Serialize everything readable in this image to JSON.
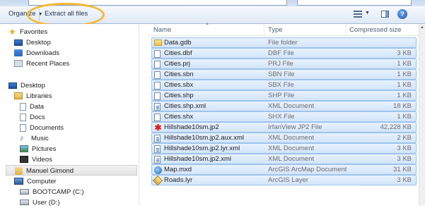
{
  "toolbar": {
    "organize_label": "Organize",
    "extract_label": "Extract all files"
  },
  "nav": {
    "favorites": "Favorites",
    "fav_items": [
      "Desktop",
      "Downloads",
      "Recent Places"
    ],
    "desktop": "Desktop",
    "libraries": "Libraries",
    "library_items": [
      "Data",
      "Docs",
      "Documents",
      "Music",
      "Pictures",
      "Videos"
    ],
    "user": "Manuel Gimond",
    "computer": "Computer",
    "drives": [
      "BOOTCAMP (C:)",
      "User (D:)"
    ]
  },
  "columns": {
    "name": "Name",
    "type": "Type",
    "size": "Compressed size"
  },
  "files": [
    {
      "name": "Data.gdb",
      "type": "File folder",
      "size": "",
      "icon": "folder-icon"
    },
    {
      "name": "Cities.dbf",
      "type": "DBF File",
      "size": "3 KB",
      "icon": "file-icon"
    },
    {
      "name": "Cities.prj",
      "type": "PRJ File",
      "size": "1 KB",
      "icon": "file-icon"
    },
    {
      "name": "Cities.sbn",
      "type": "SBN File",
      "size": "1 KB",
      "icon": "file-icon"
    },
    {
      "name": "Cities.sbx",
      "type": "SBX File",
      "size": "1 KB",
      "icon": "file-icon"
    },
    {
      "name": "Cities.shp",
      "type": "SHP File",
      "size": "1 KB",
      "icon": "file-icon"
    },
    {
      "name": "Cities.shp.xml",
      "type": "XML Document",
      "size": "18 KB",
      "icon": "xml-icon"
    },
    {
      "name": "Cities.shx",
      "type": "SHX File",
      "size": "1 KB",
      "icon": "file-icon"
    },
    {
      "name": "Hillshade10sm.jp2",
      "type": "IrfanView JP2 File",
      "size": "42,228 KB",
      "icon": "irfanview-icon"
    },
    {
      "name": "Hillshade10sm.jp2.aux.xml",
      "type": "XML Document",
      "size": "2 KB",
      "icon": "xml-icon"
    },
    {
      "name": "Hillshade10sm.jp2.lyr.xml",
      "type": "XML Document",
      "size": "3 KB",
      "icon": "xml-icon"
    },
    {
      "name": "Hillshade10sm.jp2.xml",
      "type": "XML Document",
      "size": "3 KB",
      "icon": "xml-icon"
    },
    {
      "name": "Map.mxd",
      "type": "ArcGIS ArcMap Document",
      "size": "31 KB",
      "icon": "arcmap-icon"
    },
    {
      "name": "Roads.lyr",
      "type": "ArcGIS Layer",
      "size": "3 KB",
      "icon": "layer-icon"
    }
  ],
  "colors": {
    "highlight_ring": "#f5b833",
    "selection_fill": "#d3e5fa",
    "selection_border": "#9ec4ee"
  }
}
